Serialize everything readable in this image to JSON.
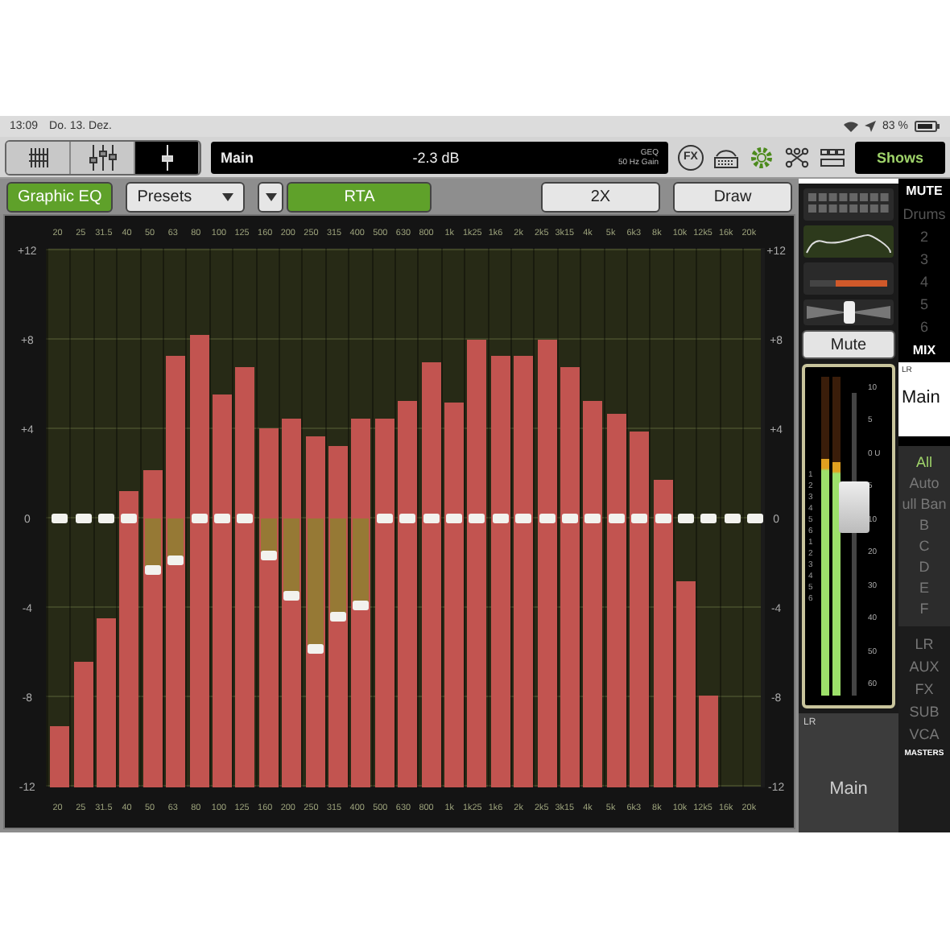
{
  "status_bar": {
    "time": "13:09",
    "date": "Do. 13. Dez.",
    "battery": "83 %"
  },
  "view_tabs": [
    {
      "kind": "grid",
      "selected": false
    },
    {
      "kind": "faders",
      "selected": false
    },
    {
      "kind": "fader",
      "selected": true
    }
  ],
  "display": {
    "channel": "Main",
    "value": "-2.3 dB",
    "param_top": "GEQ",
    "param_bottom": "50 Hz Gain"
  },
  "fx_label": "FX",
  "shows_button": "Shows",
  "controls": {
    "mode": "Graphic EQ",
    "presets": "Presets",
    "rta": {
      "label": "RTA",
      "on": true
    },
    "zoom": "2X",
    "draw": "Draw"
  },
  "eq": {
    "top_labels": [
      "20",
      "25",
      "31.5",
      "40",
      "50",
      "63",
      "80",
      "100",
      "125",
      "160",
      "200",
      "250",
      "315",
      "400",
      "500",
      "630",
      "800",
      "1k",
      "1k25",
      "1k6",
      "2k",
      "2k5",
      "3k15",
      "4k",
      "5k",
      "6k3",
      "8k",
      "10k",
      "12k5",
      "16k",
      "20k"
    ],
    "right_labels": [
      "+12",
      "+8",
      "+4",
      "0",
      "-4",
      "-8",
      "-12"
    ],
    "bottom_labels": [
      "20",
      "25",
      "31.5",
      "40",
      "50",
      "63",
      "80",
      "100",
      "125",
      "160",
      "200",
      "250",
      "315",
      "400",
      "500",
      "630",
      "800",
      "1k",
      "1k25",
      "1k6",
      "2k",
      "2k5",
      "3k15",
      "4k",
      "5k",
      "6k3",
      "8k",
      "10k",
      "12k5",
      "16k",
      "20k"
    ],
    "left_labels": [
      "+12",
      "+8",
      "+4",
      "0",
      "-4",
      "-8",
      "-12"
    ],
    "faders": [
      {
        "level": 0.5
      },
      {
        "level": 0.5
      },
      {
        "level": 0.5
      },
      {
        "level": 0.5
      },
      {
        "level": 0.404
      },
      {
        "level": 0.421
      },
      {
        "level": 0.5
      },
      {
        "level": 0.5
      },
      {
        "level": 0.5
      },
      {
        "level": 0.429
      },
      {
        "level": 0.354
      },
      {
        "level": 0.258
      },
      {
        "level": 0.317
      },
      {
        "level": 0.338
      },
      {
        "level": 0.5
      },
      {
        "level": 0.5
      },
      {
        "level": 0.5
      },
      {
        "level": 0.5
      },
      {
        "level": 0.5
      },
      {
        "level": 0.5
      },
      {
        "level": 0.5
      },
      {
        "level": 0.5
      },
      {
        "level": 0.5
      },
      {
        "level": 0.5
      },
      {
        "level": 0.5
      },
      {
        "level": 0.5
      },
      {
        "level": 0.5
      },
      {
        "level": 0.5
      },
      {
        "level": 0.5
      },
      {
        "level": 0.5
      },
      {
        "level": 0.5
      }
    ]
  },
  "strip": {
    "pan": {
      "level": 0.5
    },
    "mute": {
      "label": "Mute",
      "on": false
    },
    "meter_numbers": [
      "1",
      "2",
      "3",
      "4",
      "5",
      "6",
      "1",
      "2",
      "3",
      "4",
      "5",
      "6"
    ],
    "meter_scale": [
      "10",
      "5",
      "0 U",
      "5",
      "10",
      "20",
      "30",
      "40",
      "50",
      "60"
    ],
    "meters": [
      {
        "level": 0.74
      },
      {
        "level": 0.73
      }
    ],
    "fader": {
      "level": 0.62
    },
    "bus": "LR",
    "name": "Main"
  },
  "side": {
    "mute_title": "MUTE",
    "mute_groups": [
      "Drums",
      "2",
      "3",
      "4",
      "5",
      "6"
    ],
    "mix_title": "MIX",
    "bus": "LR",
    "bus_name": "Main",
    "filters": [
      {
        "label": "All",
        "selected": true
      },
      {
        "label": "Auto",
        "selected": false
      },
      {
        "label": "ull Ban",
        "selected": false
      },
      {
        "label": "B",
        "selected": false
      },
      {
        "label": "C",
        "selected": false
      },
      {
        "label": "D",
        "selected": false
      },
      {
        "label": "E",
        "selected": false
      },
      {
        "label": "F",
        "selected": false
      }
    ],
    "groups": [
      "LR",
      "AUX",
      "FX",
      "SUB",
      "VCA"
    ],
    "masters": "MASTERS"
  }
}
